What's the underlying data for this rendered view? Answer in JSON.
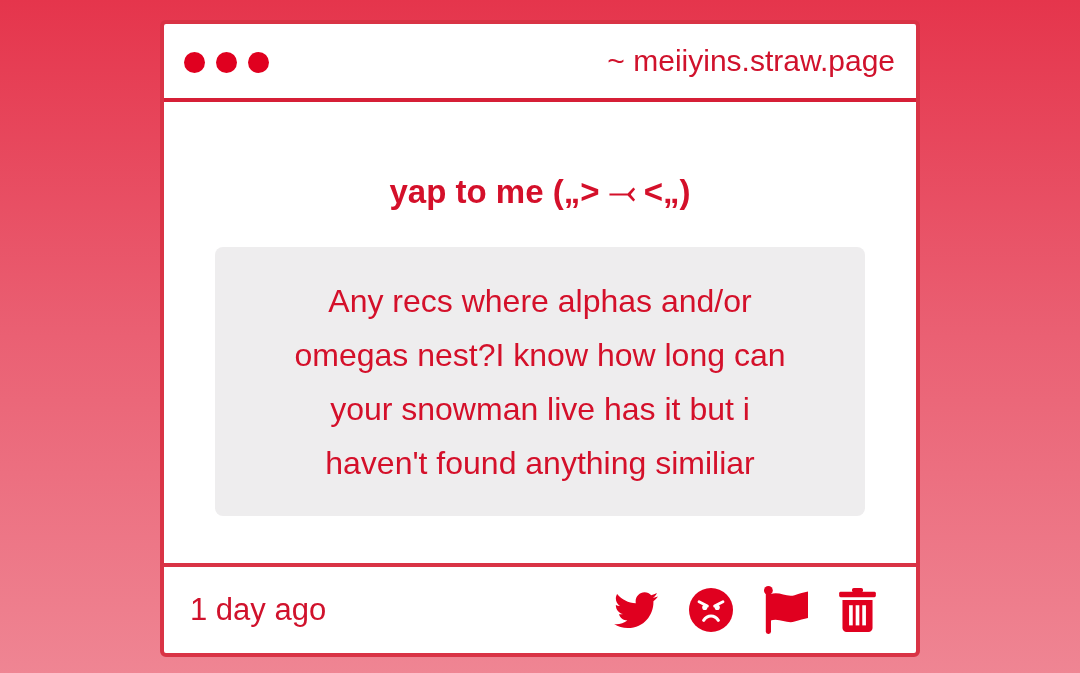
{
  "window": {
    "address": "~ meiiyins.straw.page"
  },
  "title": "yap to me („˃ ⤙ ˂„)",
  "message": {
    "text": "Any recs where alphas and/or omegas nest?I know how long can your snowman live has it but i haven't found anything similiar"
  },
  "footer": {
    "time": "1 day ago",
    "actions": [
      {
        "kind": "share"
      },
      {
        "kind": "react"
      },
      {
        "kind": "report"
      },
      {
        "kind": "delete"
      }
    ]
  }
}
